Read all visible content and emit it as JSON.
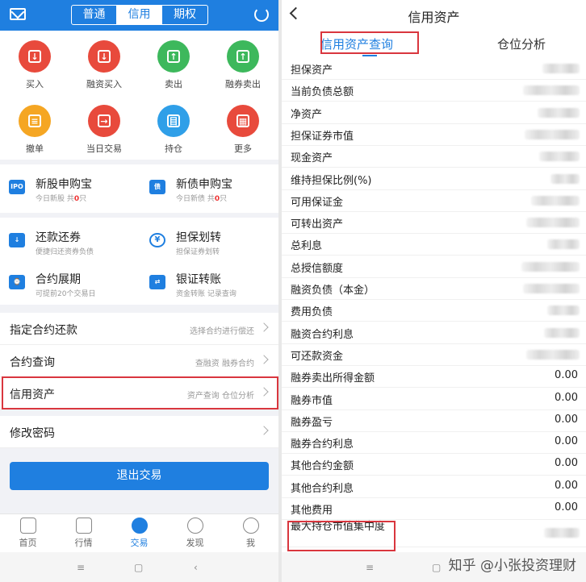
{
  "left": {
    "segments": [
      "普通",
      "信用",
      "期权"
    ],
    "icons": [
      {
        "label": "买入",
        "color": "#e84a3c",
        "glyph": "↓"
      },
      {
        "label": "融资买入",
        "color": "#e84a3c",
        "glyph": "↓"
      },
      {
        "label": "卖出",
        "color": "#3db85c",
        "glyph": "↑"
      },
      {
        "label": "融券卖出",
        "color": "#3db85c",
        "glyph": "↑"
      },
      {
        "label": "撤单",
        "color": "#f5a623",
        "glyph": "≡"
      },
      {
        "label": "当日交易",
        "color": "#e84a3c",
        "glyph": "→"
      },
      {
        "label": "持仓",
        "color": "#2f9fe8",
        "glyph": "目"
      },
      {
        "label": "更多",
        "color": "#e84a3c",
        "glyph": "▦"
      }
    ],
    "features": [
      {
        "title": "新股申购宝",
        "sub_pre": "今日新股 共",
        "sub_num": "0",
        "sub_post": "只",
        "icon": "IPO"
      },
      {
        "title": "新债申购宝",
        "sub_pre": "今日新债 共",
        "sub_num": "0",
        "sub_post": "只",
        "icon": "债"
      },
      {
        "title": "还款还券",
        "sub": "便捷归还资券负债",
        "icon": "↓"
      },
      {
        "title": "担保划转",
        "sub": "担保证券划转",
        "icon": "¥"
      },
      {
        "title": "合约展期",
        "sub": "可提前20个交易日",
        "icon": "⌚"
      },
      {
        "title": "银证转账",
        "sub": "资金转账 记录查询",
        "icon": "⇄"
      }
    ],
    "menu": [
      {
        "title": "指定合约还款",
        "sub": "选择合约进行偿还"
      },
      {
        "title": "合约查询",
        "sub": "查融资 融券合约"
      },
      {
        "title": "信用资产",
        "sub": "资产查询 仓位分析"
      },
      {
        "title": "修改密码",
        "sub": ""
      }
    ],
    "logout_label": "退出交易",
    "tabs": [
      "首页",
      "行情",
      "交易",
      "发现",
      "我"
    ],
    "nav": [
      "≡",
      "▢",
      "‹"
    ]
  },
  "right": {
    "title": "信用资产",
    "tabs": [
      "信用资产查询",
      "仓位分析"
    ],
    "rows": [
      {
        "label": "担保资产",
        "value": "",
        "blur": 46
      },
      {
        "label": "当前负债总额",
        "value": "",
        "blur": 70
      },
      {
        "label": "净资产",
        "value": "",
        "blur": 52
      },
      {
        "label": "担保证券市值",
        "value": "",
        "blur": 68
      },
      {
        "label": "现金资产",
        "value": "",
        "blur": 50
      },
      {
        "label": "维持担保比例(%)",
        "value": "",
        "blur": 36
      },
      {
        "label": "可用保证金",
        "value": "",
        "blur": 60
      },
      {
        "label": "可转出资产",
        "value": "",
        "blur": 66
      },
      {
        "label": "总利息",
        "value": "",
        "blur": 40
      },
      {
        "label": "总授信额度",
        "value": "",
        "blur": 72
      },
      {
        "label": "融资负债（本金）",
        "value": "",
        "blur": 70
      },
      {
        "label": "费用负债",
        "value": "",
        "blur": 40
      },
      {
        "label": "融资合约利息",
        "value": "",
        "blur": 44
      },
      {
        "label": "可还款资金",
        "value": "",
        "blur": 66
      },
      {
        "label": "融券卖出所得金额",
        "value": "0.00"
      },
      {
        "label": "融券市值",
        "value": "0.00"
      },
      {
        "label": "融券盈亏",
        "value": "0.00"
      },
      {
        "label": "融券合约利息",
        "value": "0.00"
      },
      {
        "label": "其他合约金额",
        "value": "0.00"
      },
      {
        "label": "其他合约利息",
        "value": "0.00"
      },
      {
        "label": "其他费用",
        "value": "0.00"
      },
      {
        "label": "最大持仓市值集中度",
        "value": "",
        "blur": 44
      }
    ],
    "watermark": "知乎 @小张投资理财",
    "nav": [
      "≡",
      "▢",
      "‹"
    ]
  }
}
